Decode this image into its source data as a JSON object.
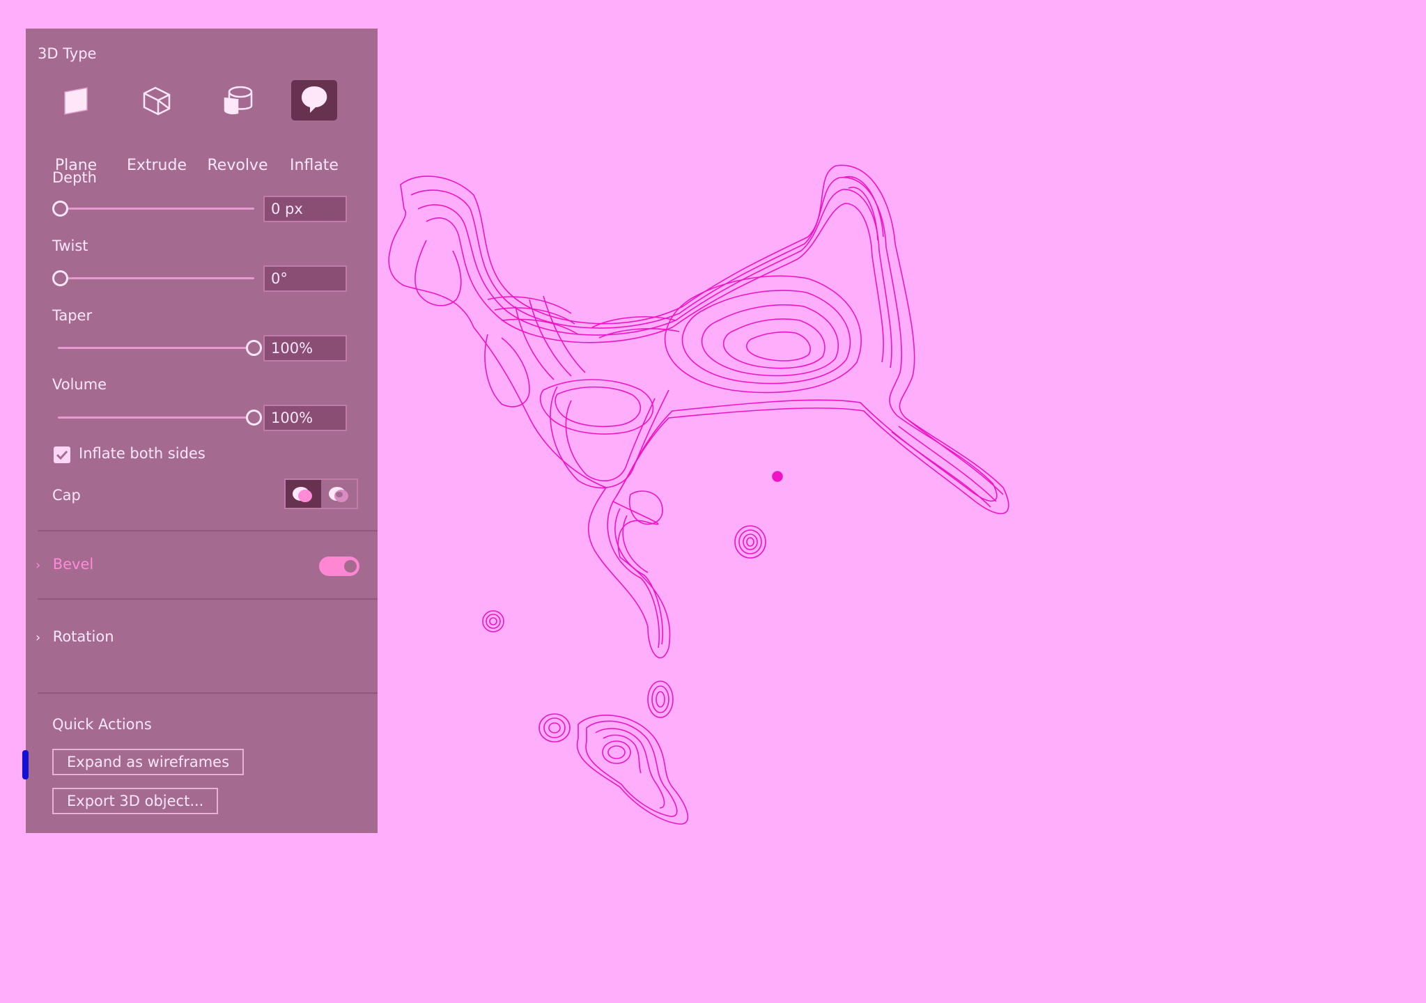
{
  "panel": {
    "title": "3D Type",
    "types": [
      {
        "label": "Plane",
        "icon": "plane-icon",
        "active": false
      },
      {
        "label": "Extrude",
        "icon": "extrude-icon",
        "active": false
      },
      {
        "label": "Revolve",
        "icon": "revolve-icon",
        "active": false
      },
      {
        "label": "Inflate",
        "icon": "inflate-icon",
        "active": true
      }
    ],
    "depth": {
      "label": "Depth",
      "value": "0 px",
      "level": 0
    },
    "twist": {
      "label": "Twist",
      "value": "0°",
      "level": 0
    },
    "taper": {
      "label": "Taper",
      "value": "100%",
      "level": 1
    },
    "volume": {
      "label": "Volume",
      "value": "100%",
      "level": 1
    },
    "inflate_both_sides": {
      "label": "Inflate both sides",
      "checked": true
    },
    "cap": {
      "label": "Cap",
      "options": [
        "cap-on-icon",
        "cap-off-icon"
      ],
      "selected": 0
    },
    "bevel": {
      "label": "Bevel",
      "enabled": true
    },
    "rotation": {
      "label": "Rotation"
    },
    "quick_actions": {
      "title": "Quick Actions",
      "expand_label": "Expand as wireframes",
      "export_label": "Export 3D object..."
    }
  },
  "colors": {
    "canvas": "#feaefa",
    "panel": "#a56a90",
    "wireframe": "#ee14c6",
    "focus": "#1311d6"
  }
}
